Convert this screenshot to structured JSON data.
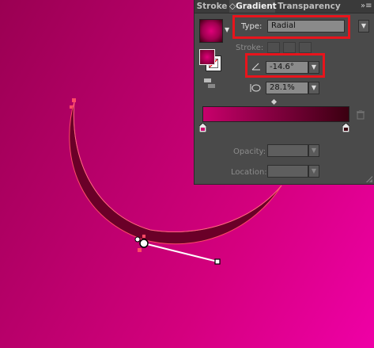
{
  "panel": {
    "tabs": [
      {
        "label": "Stroke"
      },
      {
        "label": "◇Gradient"
      },
      {
        "label": "Transparency"
      }
    ],
    "menu_icon": "»≡",
    "type_label": "Type:",
    "type_value": "Radial",
    "stroke_label": "Stroke:",
    "angle_value": "-14.6°",
    "aspect_value": "28.1%",
    "opacity_label": "Opacity:",
    "location_label": "Location:",
    "opacity_value": "",
    "location_value": ""
  },
  "colors": {
    "accent_highlight": "#e8141c",
    "gradient_start": "#c8006c",
    "gradient_end": "#3a0010"
  },
  "icons": [
    "gradient-swatch-icon",
    "fill-stroke-icon",
    "reverse-gradient-icon",
    "angle-icon",
    "aspect-ratio-icon",
    "trash-icon",
    "stop-icon",
    "midpoint-icon",
    "chevron-down-icon"
  ]
}
